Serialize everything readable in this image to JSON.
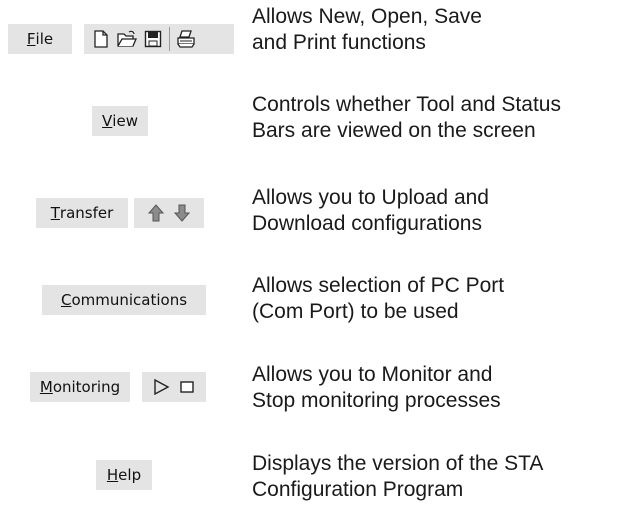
{
  "rows": [
    {
      "menu_first": "F",
      "menu_rest": "ile",
      "toolbar": [
        "new-file-icon",
        "open-folder-icon",
        "save-icon",
        "print-icon"
      ],
      "desc_lines": [
        "Allows New, Open, Save",
        "and Print functions"
      ]
    },
    {
      "menu_first": "V",
      "menu_rest": "iew",
      "toolbar": [],
      "desc_lines": [
        "Controls whether Tool and Status",
        "Bars are viewed on the screen"
      ]
    },
    {
      "menu_first": "T",
      "menu_rest": "ransfer",
      "toolbar": [
        "upload-arrow-icon",
        "download-arrow-icon"
      ],
      "desc_lines": [
        "Allows you to Upload and",
        "Download configurations"
      ]
    },
    {
      "menu_first": "C",
      "menu_rest": "ommunications",
      "toolbar": [],
      "desc_lines": [
        "Allows selection of PC Port",
        "(Com Port) to be used"
      ]
    },
    {
      "menu_first": "M",
      "menu_rest": "onitoring",
      "toolbar": [
        "play-icon",
        "stop-icon"
      ],
      "desc_lines": [
        "Allows you to Monitor and",
        "Stop monitoring processes"
      ]
    },
    {
      "menu_first": "H",
      "menu_rest": "elp",
      "toolbar": [],
      "desc_lines": [
        "Displays the version of the STA",
        "Configuration Program"
      ]
    }
  ]
}
